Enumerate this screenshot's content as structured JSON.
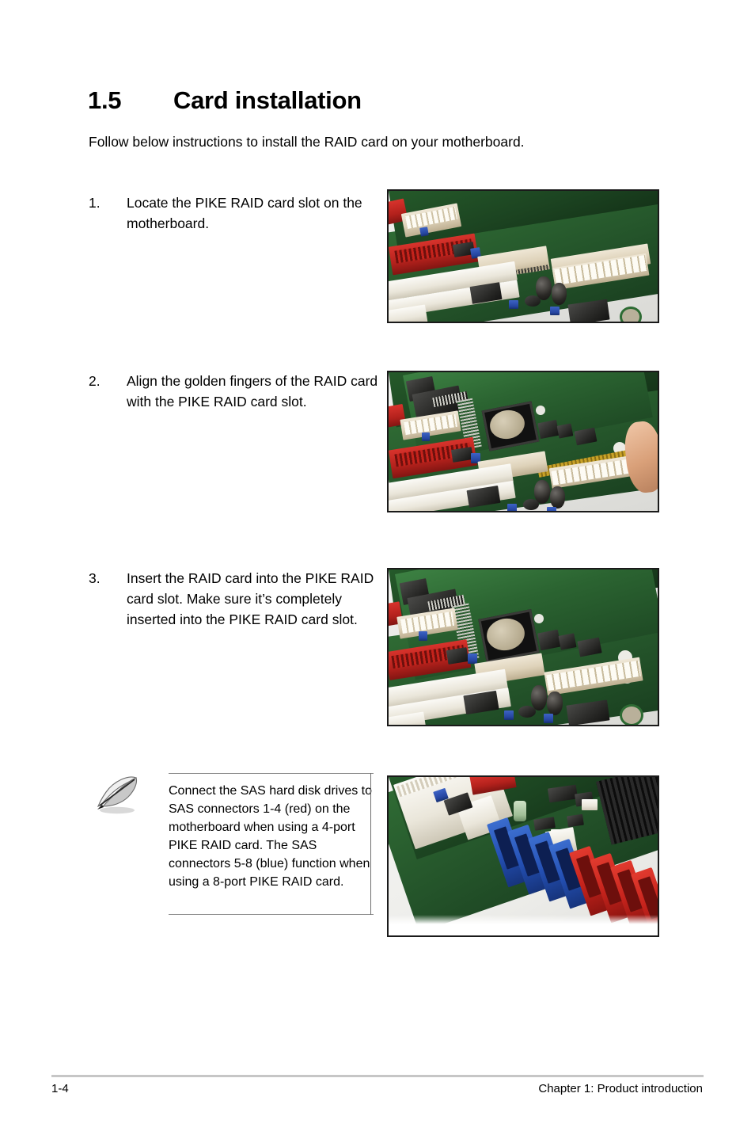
{
  "document": {
    "section_number": "1.5",
    "section_title": "Card installation",
    "intro": "Follow below instructions to install the RAID card on your motherboard."
  },
  "steps": [
    {
      "number": "1.",
      "text": "Locate the PIKE RAID card slot on the motherboard.",
      "figure_alt": "motherboard-pike-raid-card-slot-photo"
    },
    {
      "number": "2.",
      "text": "Align the golden fingers of the RAID card with the PIKE RAID card slot.",
      "figure_alt": "raid-card-aligned-over-slot-photo"
    },
    {
      "number": "3.",
      "text": "Insert the RAID card into the PIKE RAID card slot. Make sure it’s completely inserted into the PIKE RAID card slot.",
      "figure_alt": "raid-card-inserted-into-slot-photo"
    }
  ],
  "note": {
    "icon": "pencil-note-icon",
    "text": "Connect the SAS hard disk drives to SAS connectors 1-4 (red) on the motherboard when using a 4-port PIKE RAID card. The SAS connectors 5-8 (blue) function when using a 8-port PIKE RAID card.",
    "figure_alt": "sas-connectors-blue-and-red-photo"
  },
  "footer": {
    "page_number": "1-4",
    "chapter": "Chapter 1: Product introduction"
  },
  "colors": {
    "text": "#000000",
    "rule": "#c6c6c6",
    "note_rule": "#8c8c8c",
    "sas_red": "#c5231c",
    "sas_blue": "#2450b4",
    "pcb_green": "#2b6431",
    "gold": "#c9a227"
  }
}
